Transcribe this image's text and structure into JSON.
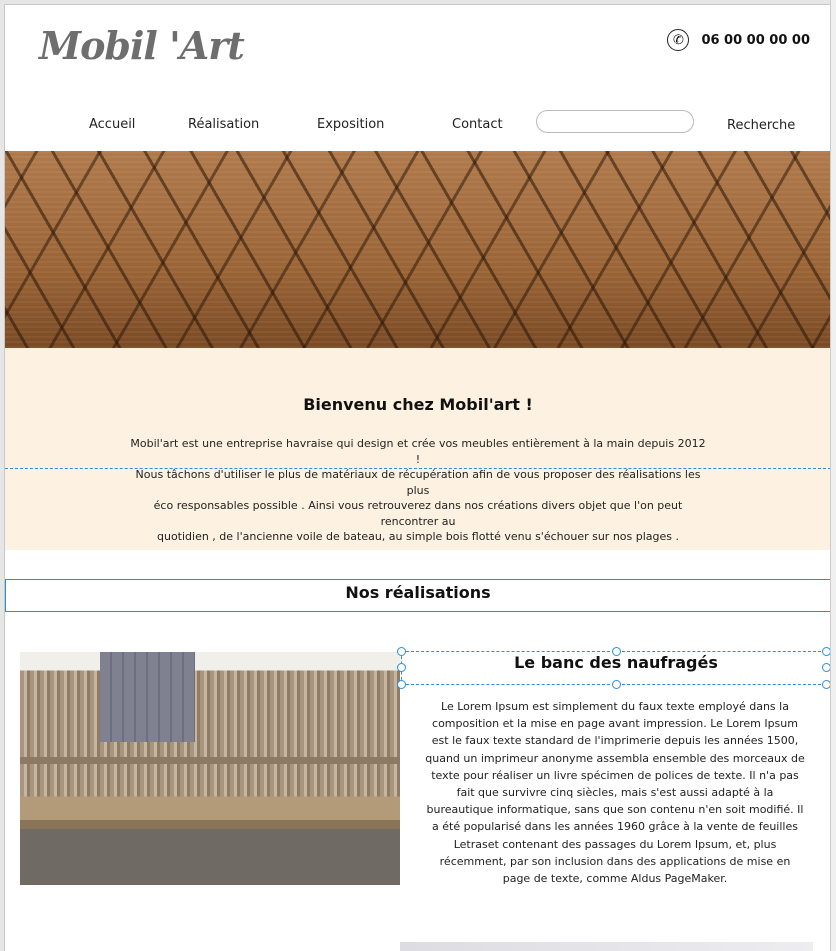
{
  "header": {
    "logo": "Mobil 'Art",
    "phone": "06 00 00 00 00",
    "phone_icon": "phone-icon"
  },
  "nav": {
    "items": [
      {
        "label": "Accueil"
      },
      {
        "label": "Réalisation"
      },
      {
        "label": "Exposition"
      },
      {
        "label": "Contact"
      }
    ],
    "search_value": "",
    "search_label": "Recherche"
  },
  "intro": {
    "title": "Bienvenu chez Mobil'art !",
    "lines": [
      "Mobil'art est une entreprise havraise qui design et crée vos meubles entièrement à la main depuis 2012 !",
      "Nous tâchons d'utiliser le plus de matériaux de récupération afin de vous proposer des réalisations les plus",
      "éco responsables possible . Ainsi vous retrouverez dans nos créations divers objet que l'on peut rencontrer au",
      "quotidien , de l'ancienne voile de bateau, au simple bois flotté venu s'échouer sur nos plages ."
    ]
  },
  "section": {
    "title": "Nos réalisations"
  },
  "card": {
    "title": "Le banc des naufragés",
    "text": "Le Lorem Ipsum est simplement du faux texte employé dans la composition et la mise en page avant impression. Le Lorem Ipsum est le faux texte standard de l'imprimerie depuis les années 1500, quand un imprimeur anonyme assembla ensemble des morceaux de texte pour réaliser un livre spécimen de polices de texte. Il n'a pas fait que survivre cinq siècles, mais s'est aussi adapté à la bureautique informatique, sans que son contenu n'en soit modifié. Il a été popularisé dans les années 1960 grâce à la vente de feuilles Letraset contenant des passages du Lorem Ipsum, et, plus récemment, par son inclusion dans des applications de mise en page de texte, comme Aldus PageMaker."
  },
  "colors": {
    "intro_bg": "#fdf2e1",
    "selection": "#2b8de0",
    "logo": "#6e6e6e"
  }
}
